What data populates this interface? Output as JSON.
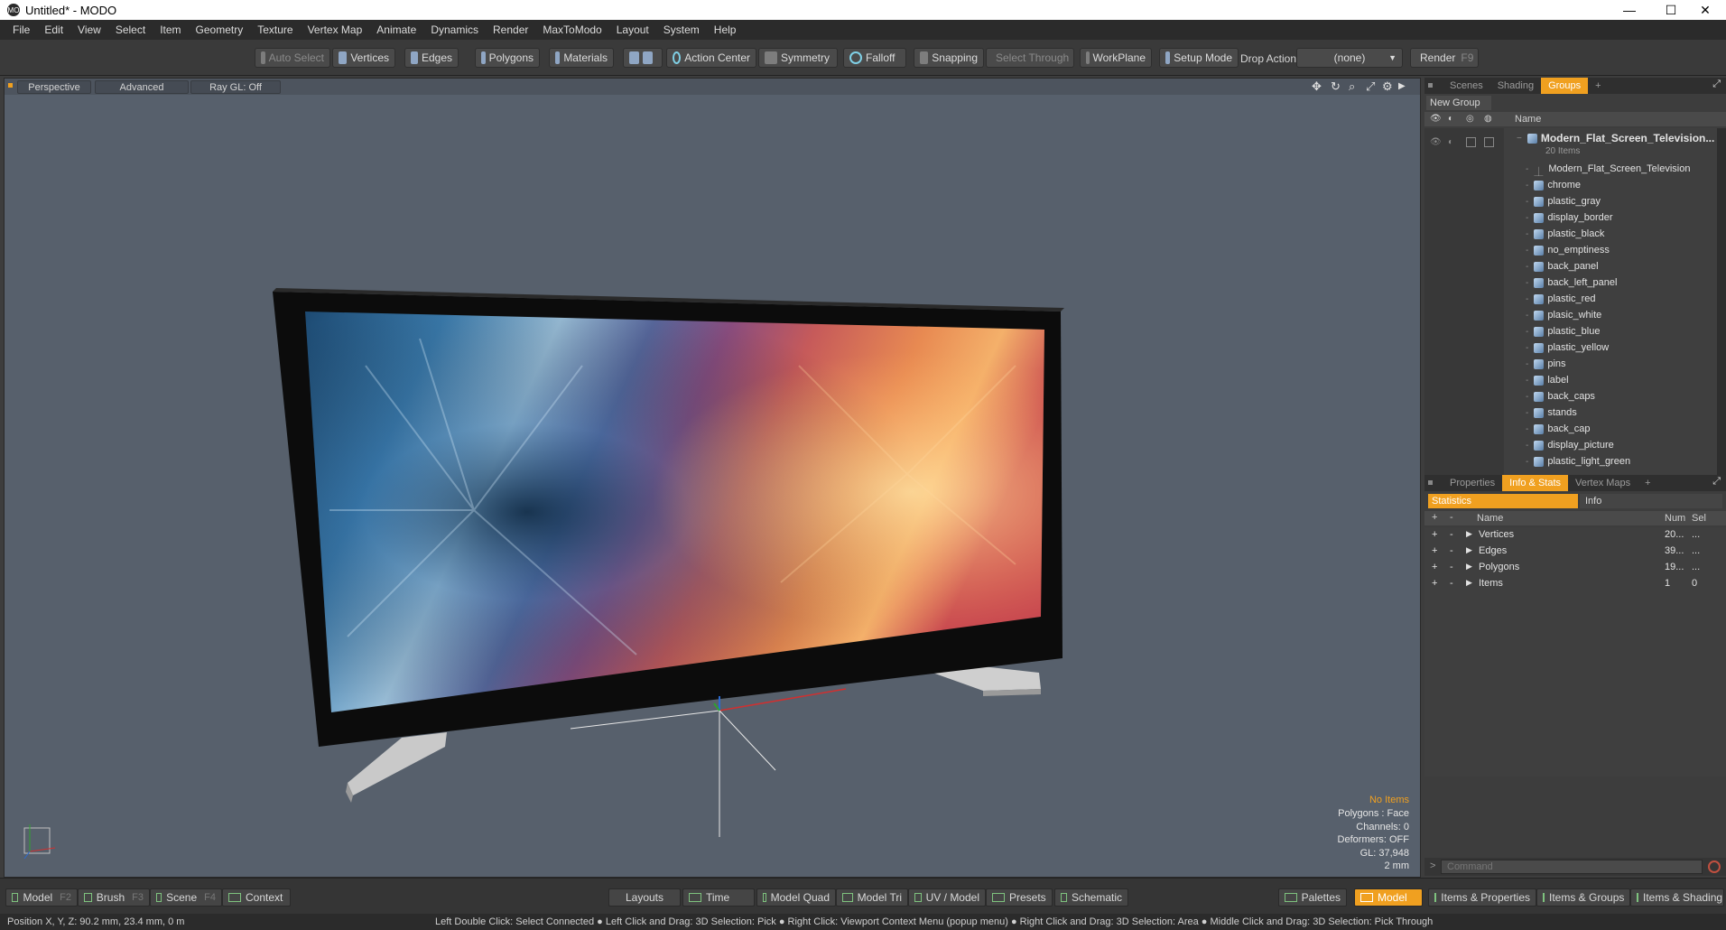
{
  "window": {
    "title": "Untitled* - MODO",
    "logo": "MO",
    "min": "—",
    "max": "☐",
    "close": "✕"
  },
  "menu": [
    "File",
    "Edit",
    "View",
    "Select",
    "Item",
    "Geometry",
    "Texture",
    "Vertex Map",
    "Animate",
    "Dynamics",
    "Render",
    "MaxToModo",
    "Layout",
    "System",
    "Help"
  ],
  "toolbar": {
    "auto_select": "Auto Select",
    "vertices": "Vertices",
    "edges": "Edges",
    "polygons": "Polygons",
    "materials": "Materials",
    "action_center": "Action Center",
    "symmetry": "Symmetry",
    "falloff": "Falloff",
    "snapping": "Snapping",
    "select_through": "Select Through",
    "workplane": "WorkPlane",
    "setup_mode": "Setup Mode",
    "drop_action_label": "Drop Action",
    "drop_action_value": "(none)",
    "render": "Render",
    "render_key": "F9"
  },
  "viewport": {
    "view": "Perspective",
    "mode": "Advanced",
    "raygl": "Ray GL: Off",
    "stats": {
      "items": "No Items",
      "polygons": "Polygons : Face",
      "channels": "Channels: 0",
      "deformers": "Deformers: OFF",
      "gl": "GL: 37,948",
      "units": "2 mm"
    }
  },
  "groups_panel": {
    "tabs": [
      "Scenes",
      "Shading",
      "Groups"
    ],
    "active_tab": "Groups",
    "new_group": "New Group",
    "col_name": "Name",
    "root": {
      "name": "Modern_Flat_Screen_Television...",
      "count": "20 Items"
    },
    "items": [
      "Modern_Flat_Screen_Television",
      "chrome",
      "plastic_gray",
      "display_border",
      "plastic_black",
      "no_emptiness",
      "back_panel",
      "back_left_panel",
      "plastic_red",
      "plasic_white",
      "plastic_blue",
      "plastic_yellow",
      "pins",
      "label",
      "back_caps",
      "stands",
      "back_cap",
      "display_picture",
      "plastic_light_green"
    ]
  },
  "info_panel": {
    "tabs": [
      "Properties",
      "Info & Stats",
      "Vertex Maps"
    ],
    "active_tab": "Info & Stats",
    "sub_tabs": [
      "Statistics",
      "Info"
    ],
    "columns": {
      "name": "Name",
      "num": "Num",
      "sel": "Sel"
    },
    "rows": [
      {
        "name": "Vertices",
        "num": "20...",
        "sel": "..."
      },
      {
        "name": "Edges",
        "num": "39...",
        "sel": "..."
      },
      {
        "name": "Polygons",
        "num": "19...",
        "sel": "..."
      },
      {
        "name": "Items",
        "num": "1",
        "sel": "0"
      }
    ],
    "command_placeholder": "Command"
  },
  "bottom": {
    "model": "Model",
    "model_key": "F2",
    "brush": "Brush",
    "brush_key": "F3",
    "scene": "Scene",
    "scene_key": "F4",
    "context": "Context",
    "layouts": "Layouts",
    "time": "Time",
    "model_quad": "Model Quad",
    "model_tri": "Model Tri",
    "uv_model": "UV / Model",
    "presets": "Presets",
    "schematic": "Schematic",
    "palettes": "Palettes",
    "model_active": "Model",
    "items_properties": "Items & Properties",
    "items_groups": "Items & Groups",
    "items_shading": "Items & Shading"
  },
  "status": {
    "position": "Position X, Y, Z:   90.2 mm, 23.4 mm, 0 m",
    "hint": "Left Double Click: Select Connected ● Left Click and Drag: 3D Selection: Pick ● Right Click: Viewport Context Menu (popup menu) ● Right Click and Drag: 3D Selection: Area ● Middle Click and Drag: 3D Selection: Pick Through"
  },
  "colors": {
    "accent": "#f0a020",
    "viewport_bg": "#57606c"
  }
}
